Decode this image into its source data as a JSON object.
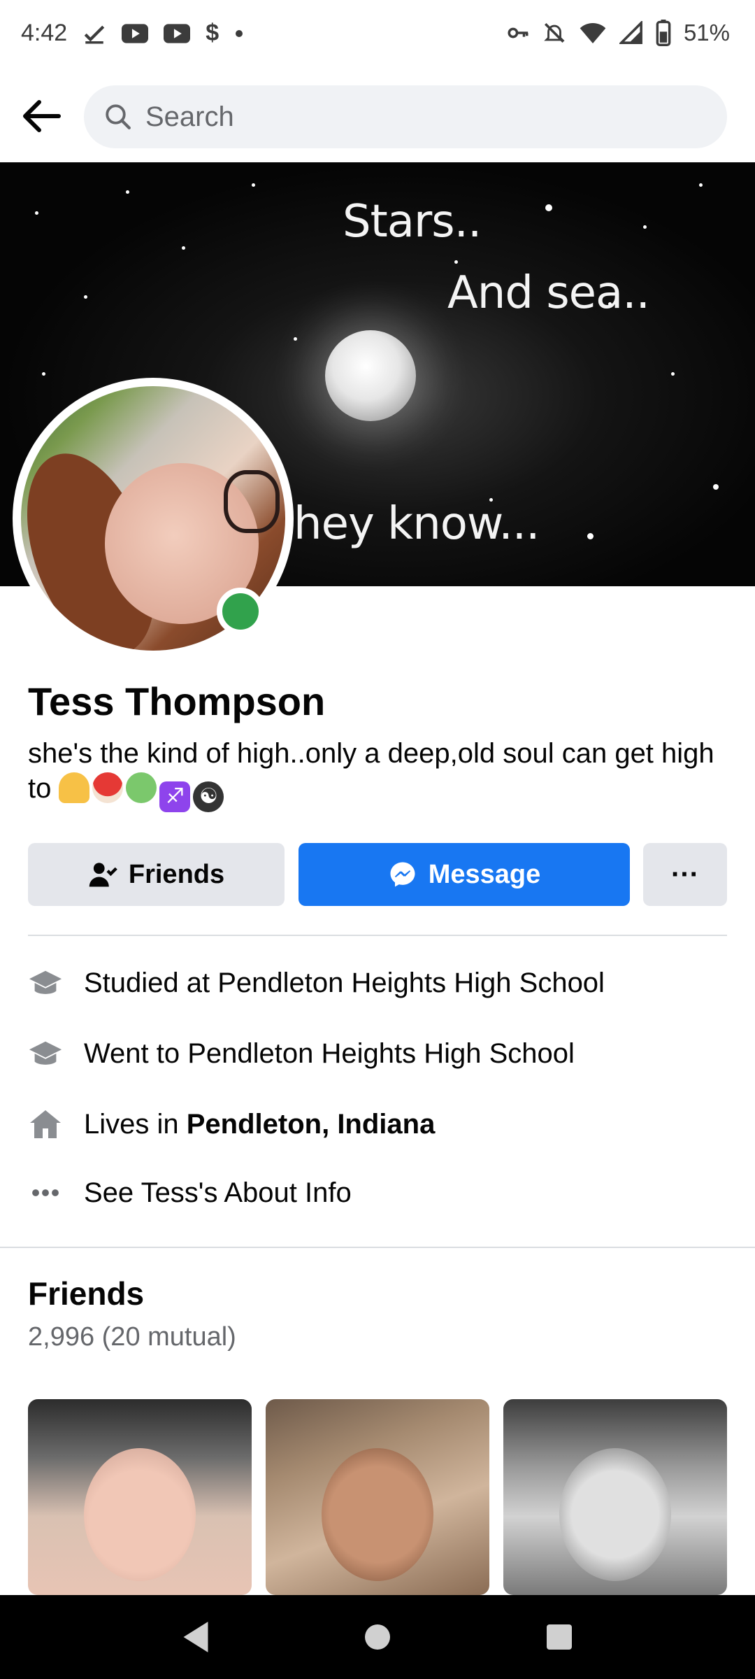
{
  "status_bar": {
    "time": "4:42",
    "battery": "51%"
  },
  "search": {
    "placeholder": "Search"
  },
  "cover": {
    "lines": [
      "Stars..",
      "And sea..",
      "hey know..."
    ]
  },
  "profile": {
    "name": "Tess Thompson",
    "bio_text": "she's the kind of high..only a deep,old soul can get high to",
    "bio_emojis": [
      "victory-hand",
      "mushroom",
      "recycling",
      "sagittarius",
      "yin-yang"
    ]
  },
  "actions": {
    "friends_label": "Friends",
    "message_label": "Message",
    "more_label": "···"
  },
  "about": {
    "studied": "Studied at Pendleton Heights High School",
    "went_to": "Went to Pendleton Heights High School",
    "lives_prefix": "Lives in ",
    "lives_place": "Pendleton, Indiana",
    "see_about": "See Tess's About Info"
  },
  "friends": {
    "title": "Friends",
    "count": "2,996 (20 mutual)"
  },
  "colors": {
    "primary": "#1877f2",
    "online": "#31a24c",
    "secondary_btn": "#e4e6eb"
  }
}
